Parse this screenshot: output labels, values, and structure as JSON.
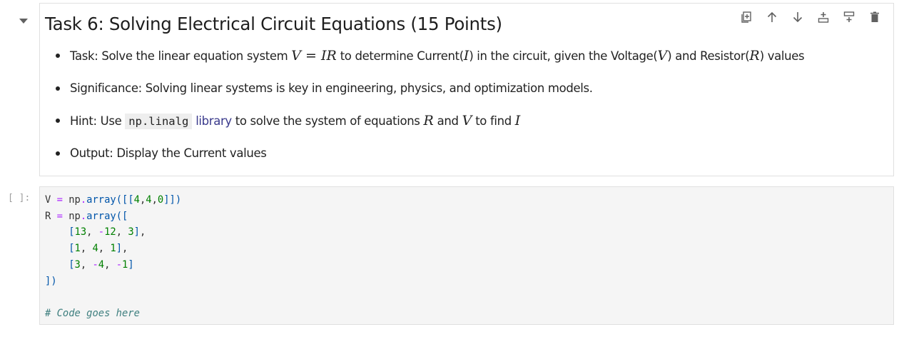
{
  "markdown_cell": {
    "title": "Task 6: Solving Electrical Circuit Equations (15 Points)",
    "toolbar": [
      "duplicate-cell-icon",
      "move-up-icon",
      "move-down-icon",
      "insert-above-icon",
      "insert-below-icon",
      "delete-icon"
    ],
    "bullets": [
      {
        "prefix": "Task: Solve the linear equation system ",
        "eq": "V = IR",
        "middle1": " to determine Current(",
        "var_i": "I",
        "middle2": ") in the circuit, given the Voltage(",
        "var_v": "V",
        "middle3": ") and Resistor(",
        "var_r": "R",
        "suffix": ") values"
      },
      {
        "text": "Significance: Solving linear systems is key in engineering, physics, and optimization models."
      },
      {
        "prefix": "Hint: Use ",
        "code": "np.linalg",
        "link": "library",
        "middle": " to solve the system of equations ",
        "var_r": "R",
        "and": " and ",
        "var_v": "V",
        "to_find": " to find ",
        "var_i": "I"
      },
      {
        "text": "Output: Display the Current values"
      }
    ]
  },
  "code_cell": {
    "prompt": "[ ]:",
    "lines": [
      "V = np.array([[4,4,0]])",
      "R = np.array([",
      "    [13, -12, 3],",
      "    [1, 4, 1],",
      "    [3, -4, -1]",
      "])",
      "",
      "# Code goes here"
    ]
  },
  "colors": {
    "keyword_op": "#aa22ff",
    "function": "#0055aa",
    "number": "#008000",
    "comment": "#408080",
    "link": "#3a3a8c"
  }
}
